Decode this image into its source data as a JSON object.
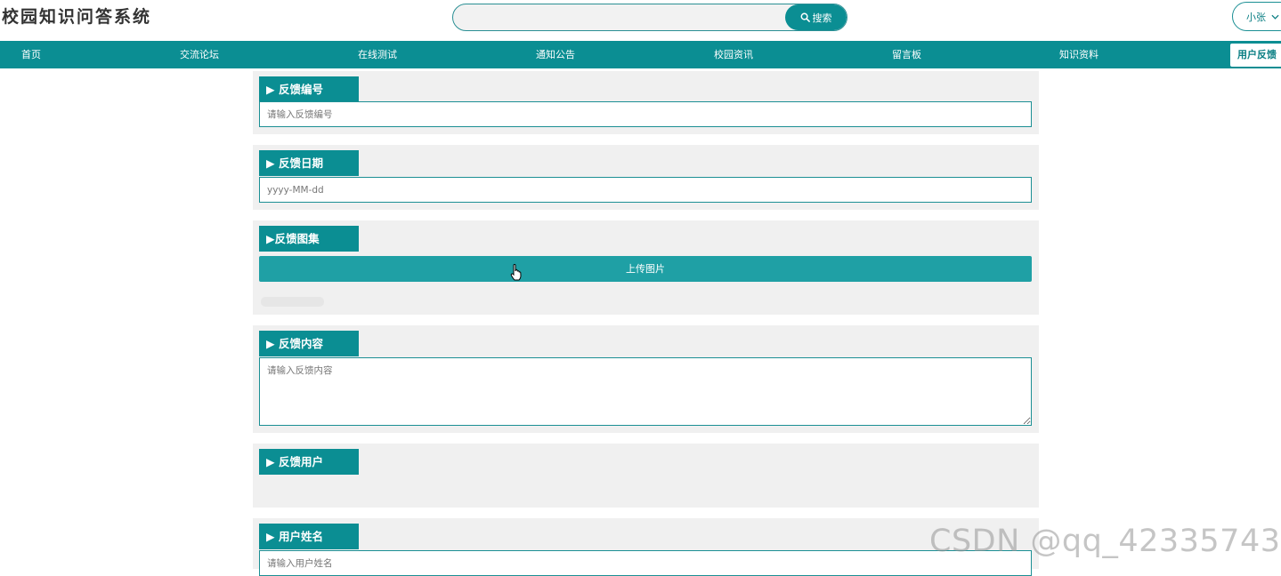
{
  "header": {
    "site_title": "校园知识问答系统",
    "search": {
      "value": "",
      "placeholder": "",
      "button_label": "搜索",
      "button_icon": "search-icon"
    },
    "user_menu": {
      "label": "小张",
      "icon": "chevron-down-icon"
    }
  },
  "nav": {
    "items": [
      {
        "label": "首页"
      },
      {
        "label": "交流论坛"
      },
      {
        "label": "在线测试"
      },
      {
        "label": "通知公告"
      },
      {
        "label": "校园资讯"
      },
      {
        "label": "留言板"
      },
      {
        "label": "知识资料"
      },
      {
        "label": "用户反馈",
        "active": true
      }
    ]
  },
  "form": {
    "feedback_no": {
      "label": "▶ 反馈编号",
      "placeholder": "请输入反馈编号",
      "value": ""
    },
    "feedback_date": {
      "label": "▶ 反馈日期",
      "placeholder": "yyyy-MM-dd",
      "value": ""
    },
    "feedback_images": {
      "label": "▶反馈图集",
      "upload_label": "上传图片"
    },
    "feedback_content": {
      "label": "▶ 反馈内容",
      "placeholder": "请输入反馈内容",
      "value": ""
    },
    "feedback_user": {
      "label": "▶ 反馈用户"
    },
    "user_name": {
      "label": "▶ 用户姓名",
      "placeholder": "请输入用户姓名",
      "value": ""
    }
  },
  "watermark": "CSDN @qq_42335743",
  "colors": {
    "primary": "#0b8e93",
    "upload_button": "#1fa0a5",
    "block_background": "#f0f0f0"
  }
}
